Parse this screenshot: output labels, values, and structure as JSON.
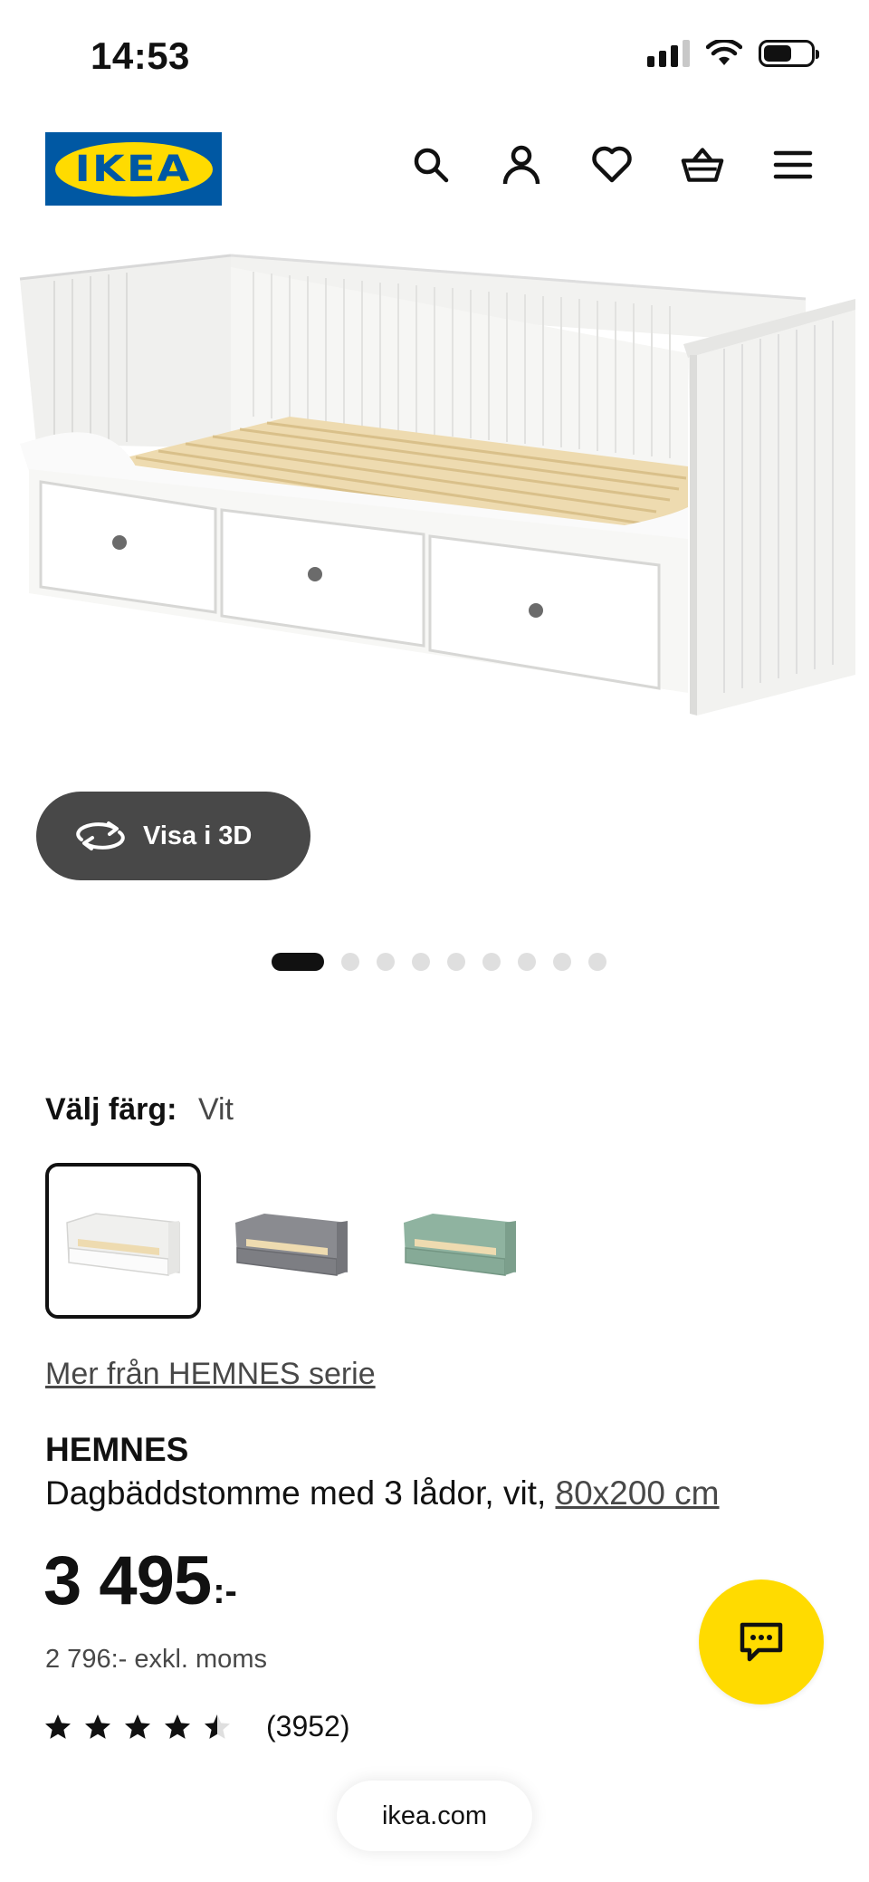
{
  "status_bar": {
    "time": "14:53"
  },
  "header": {
    "logo_text": "IKEA",
    "icons": [
      "search-icon",
      "account-icon",
      "heart-icon",
      "basket-icon",
      "menu-icon"
    ]
  },
  "gallery": {
    "view_3d_label": "Visa i 3D",
    "dot_count": 9,
    "active_dot": 0
  },
  "color_select": {
    "label": "Välj färg:",
    "value": "Vit",
    "options": [
      {
        "name": "white",
        "color": "#f4f4f2",
        "selected": true
      },
      {
        "name": "grey",
        "color": "#8a8b90",
        "selected": false
      },
      {
        "name": "green",
        "color": "#8fb3a0",
        "selected": false
      }
    ]
  },
  "series_link": "Mer från HEMNES serie",
  "product": {
    "name": "HEMNES",
    "description": "Dagbäddstomme med 3 lådor, vit,",
    "size_link": "80x200 cm"
  },
  "price": {
    "amount": "3 495",
    "suffix": ":-",
    "excl_vat": "2 796:- exkl. moms"
  },
  "rating": {
    "stars": 4.5,
    "max": 5,
    "count": "(3952)"
  },
  "browser": {
    "url": "ikea.com"
  },
  "colors": {
    "ikea_blue": "#0058a3",
    "ikea_yellow": "#ffdb00",
    "dark_button": "#484848"
  }
}
